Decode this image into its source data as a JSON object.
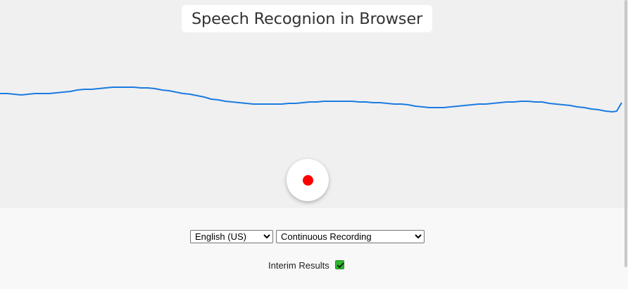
{
  "title": "Speech Recognion in Browser",
  "waveform": {
    "color": "#1a7be0"
  },
  "record": {
    "dot_color": "#ff0000"
  },
  "controls": {
    "language": {
      "selected": "English (US)"
    },
    "mode": {
      "selected": "Continuous Recording"
    },
    "interim": {
      "label": "Interim Results",
      "checked": true,
      "color": "#2fb52f"
    }
  }
}
